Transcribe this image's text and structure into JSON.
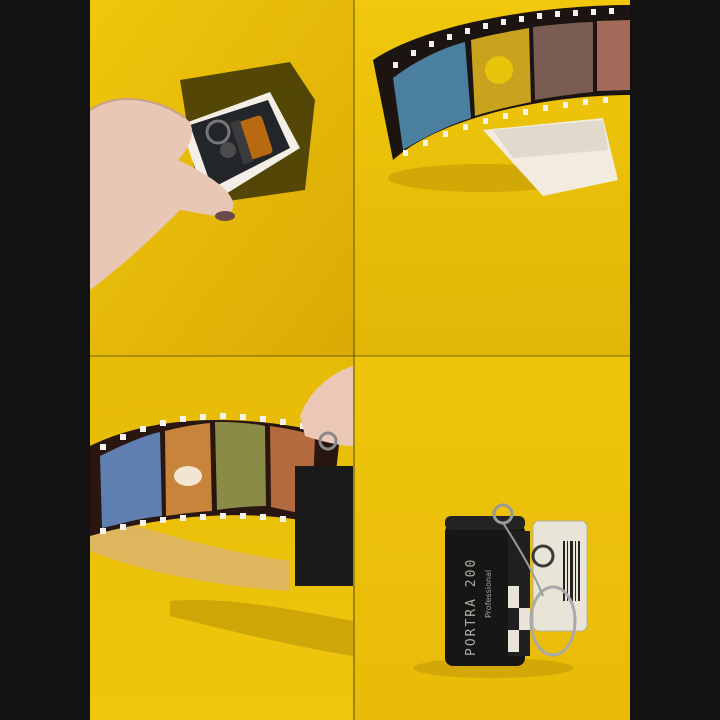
{
  "canister_label": {
    "line1": "Professional",
    "line2": "PORTRA 200"
  },
  "colors": {
    "yellow": "#e8c00a",
    "yellow_deep": "#d9ab05",
    "frame": "#141414",
    "film_dark": "#2a1a14"
  }
}
